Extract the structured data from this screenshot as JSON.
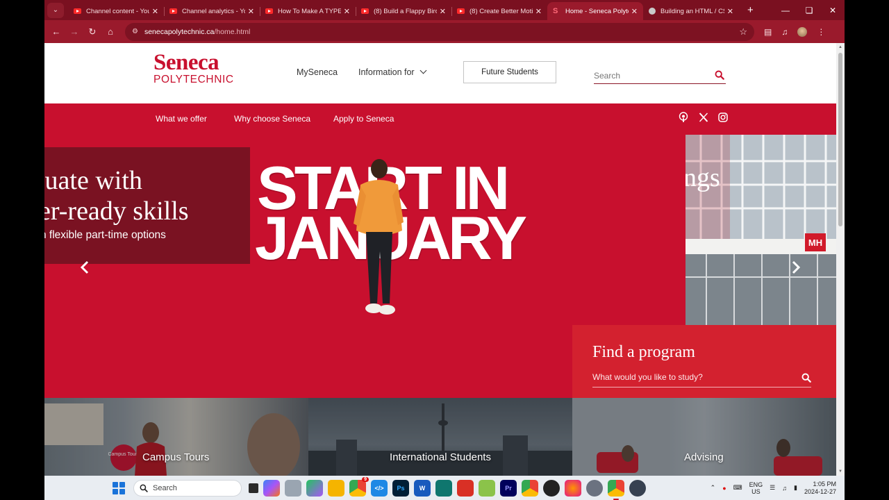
{
  "browser": {
    "tabs": [
      {
        "title": "Channel content - You",
        "icon": "youtube-icon",
        "active": false
      },
      {
        "title": "Channel analytics - You",
        "icon": "youtube-icon",
        "active": false
      },
      {
        "title": "How To Make A TYPEW",
        "icon": "youtube-icon",
        "active": false
      },
      {
        "title": "(8) Build a Flappy Bird",
        "icon": "youtube-icon",
        "active": false
      },
      {
        "title": "(8) Create Better Motio",
        "icon": "youtube-icon",
        "active": false
      },
      {
        "title": "Home - Seneca Polyte",
        "icon": "seneca-icon",
        "active": true
      },
      {
        "title": "Building an HTML / CS",
        "icon": "globe-icon",
        "active": false
      }
    ],
    "new_tab": "+",
    "url_host": "senecapolytechnic.ca",
    "url_path": "/home.html"
  },
  "header": {
    "logo_word": "Seneca",
    "logo_sub": "POLYTECHNIC",
    "nav": [
      "MySeneca",
      "Information for"
    ],
    "future_button": "Future Students",
    "search_placeholder": "Search"
  },
  "subnav": [
    "What we offer",
    "Why choose Seneca",
    "Apply to Seneca"
  ],
  "social": [
    "podcast-icon",
    "x-icon",
    "instagram-icon"
  ],
  "hero": {
    "left_line1": "luate with",
    "left_line2": "er-ready skills",
    "left_sub": "n flexible part-time options",
    "main_line1": "START IN",
    "main_line2": "JANUARY",
    "right_word": "ngs",
    "building_sign": "MH"
  },
  "find_program": {
    "title": "Find a program",
    "placeholder": "What would you like to study?"
  },
  "tiles": [
    "Campus Tours",
    "International Students",
    "Advising"
  ],
  "tile_badge": "Campus Tours",
  "taskbar": {
    "search": "Search",
    "lang_top": "ENG",
    "lang_bottom": "US",
    "time": "1:05 PM",
    "date": "2024-12-27",
    "badge": "9"
  },
  "colors": {
    "brand_red": "#c8102e",
    "dark_red": "#7a1222",
    "chrome_red": "#9a1a2c"
  }
}
